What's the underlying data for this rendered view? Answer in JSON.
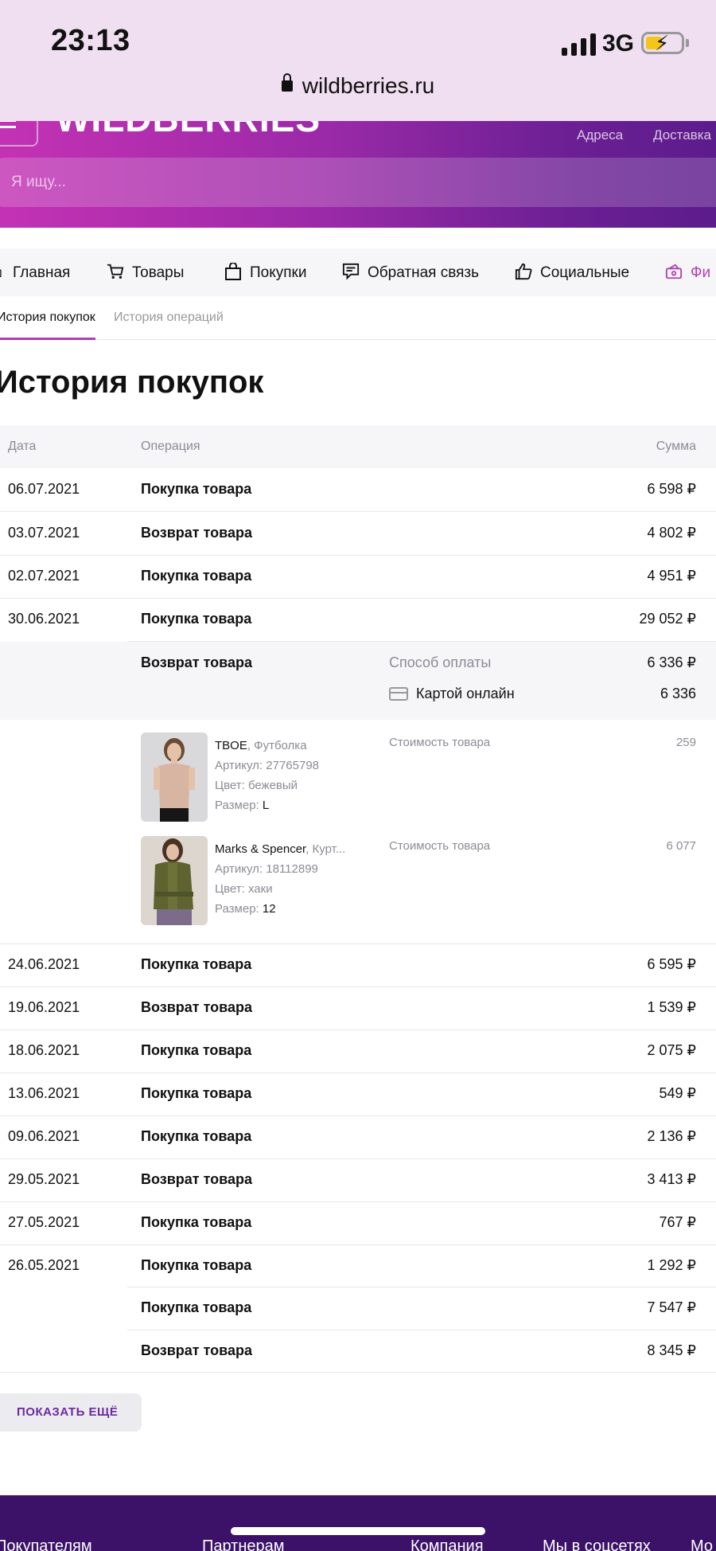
{
  "status_bar": {
    "time": "23:13",
    "network": "3G",
    "url": "wildberries.ru"
  },
  "header": {
    "logo": "WILDBERRIES",
    "links": [
      "Адреса",
      "Доставка"
    ],
    "search_placeholder": "Я ищу..."
  },
  "nav": {
    "items": [
      {
        "label": "Главная",
        "icon": "home-icon"
      },
      {
        "label": "Товары",
        "icon": "cart-icon"
      },
      {
        "label": "Покупки",
        "icon": "bag-icon"
      },
      {
        "label": "Обратная связь",
        "icon": "feedback-icon"
      },
      {
        "label": "Социальные",
        "icon": "thumbs-up-icon"
      },
      {
        "label": "Фи",
        "icon": "finance-icon"
      }
    ]
  },
  "tabs": [
    {
      "label": "История покупок",
      "active": true
    },
    {
      "label": "История операций",
      "active": false
    }
  ],
  "page_title": "История покупок",
  "table": {
    "headers": {
      "date": "Дата",
      "operation": "Операция",
      "sum": "Сумма"
    },
    "rows_top": [
      {
        "date": "06.07.2021",
        "operation": "Покупка товара",
        "sum": "6 598 ₽"
      },
      {
        "date": "03.07.2021",
        "operation": "Возврат товара",
        "sum": "4 802 ₽"
      },
      {
        "date": "02.07.2021",
        "operation": "Покупка товара",
        "sum": "4 951 ₽"
      },
      {
        "date": "30.06.2021",
        "operation": "Покупка товара",
        "sum": "29 052 ₽"
      }
    ],
    "expanded": {
      "operation": "Возврат товара",
      "payment_label": "Способ оплаты",
      "payment_sum": "6 336 ₽",
      "card_label": "Картой онлайн",
      "card_sum": "6 336",
      "products": [
        {
          "brand": "TBOE",
          "name": ", Футболка",
          "article_label": "Артикул: ",
          "article": "27765798",
          "color_label": "Цвет: ",
          "color": "бежевый",
          "size_label": "Размер: ",
          "size": "L",
          "cost_label": "Стоимость товара",
          "cost": "259"
        },
        {
          "brand": "Marks & Spencer",
          "name": ", Курт...",
          "article_label": "Артикул: ",
          "article": "18112899",
          "color_label": "Цвет: ",
          "color": "хаки",
          "size_label": "Размер: ",
          "size": "12",
          "cost_label": "Стоимость товара",
          "cost": "6 077"
        }
      ]
    },
    "rows_bottom": [
      {
        "date": "24.06.2021",
        "operation": "Покупка товара",
        "sum": "6 595 ₽"
      },
      {
        "date": "19.06.2021",
        "operation": "Возврат товара",
        "sum": "1 539 ₽"
      },
      {
        "date": "18.06.2021",
        "operation": "Покупка товара",
        "sum": "2 075 ₽"
      },
      {
        "date": "13.06.2021",
        "operation": "Покупка товара",
        "sum": "549 ₽"
      },
      {
        "date": "09.06.2021",
        "operation": "Покупка товара",
        "sum": "2 136 ₽"
      },
      {
        "date": "29.05.2021",
        "operation": "Возврат товара",
        "sum": "3 413 ₽"
      },
      {
        "date": "27.05.2021",
        "operation": "Покупка товара",
        "sum": "767 ₽"
      },
      {
        "date": "26.05.2021",
        "operation": "Покупка товара",
        "sum": "1 292 ₽"
      },
      {
        "date": "",
        "operation": "Покупка товара",
        "sum": "7 547 ₽"
      },
      {
        "date": "",
        "operation": "Возврат товара",
        "sum": "8 345 ₽"
      }
    ]
  },
  "show_more": "ПОКАЗАТЬ ЕЩЁ",
  "footer": {
    "links": [
      "Покупателям",
      "Партнерам",
      "Компания",
      "Мы в соцсетях",
      "Мо"
    ]
  },
  "colors": {
    "accent": "#b23fb0",
    "brand_dark": "#5c1c8c",
    "footer": "#3b1268"
  }
}
